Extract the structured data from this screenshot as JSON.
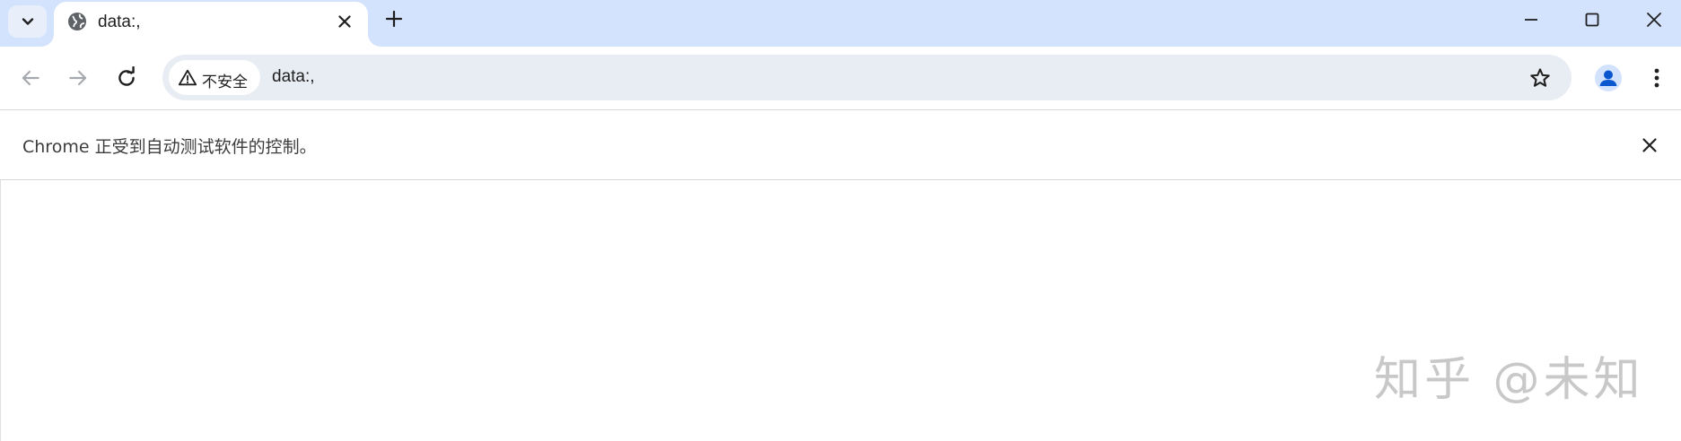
{
  "tab": {
    "title": "data:,"
  },
  "omnibox": {
    "security_label": "不安全",
    "url": "data:,"
  },
  "infobar": {
    "message": "Chrome 正受到自动测试软件的控制。"
  },
  "watermark": {
    "text": "知乎 @未知"
  },
  "icons": {
    "tab_search": "chevron-down-icon",
    "favicon": "globe-icon",
    "tab_close": "close-icon",
    "new_tab": "plus-icon",
    "minimize": "minimize-icon",
    "maximize": "maximize-icon",
    "window_close": "close-icon",
    "back": "arrow-left-icon",
    "forward": "arrow-right-icon",
    "reload": "reload-icon",
    "warning": "warning-icon",
    "bookmark": "star-icon",
    "profile": "person-icon",
    "menu": "more-vert-icon",
    "infobar_close": "close-icon"
  },
  "colors": {
    "tabstrip_bg": "#d3e3fd",
    "omnibox_bg": "#e8ecf3",
    "profile_accent": "#0b57d0"
  }
}
